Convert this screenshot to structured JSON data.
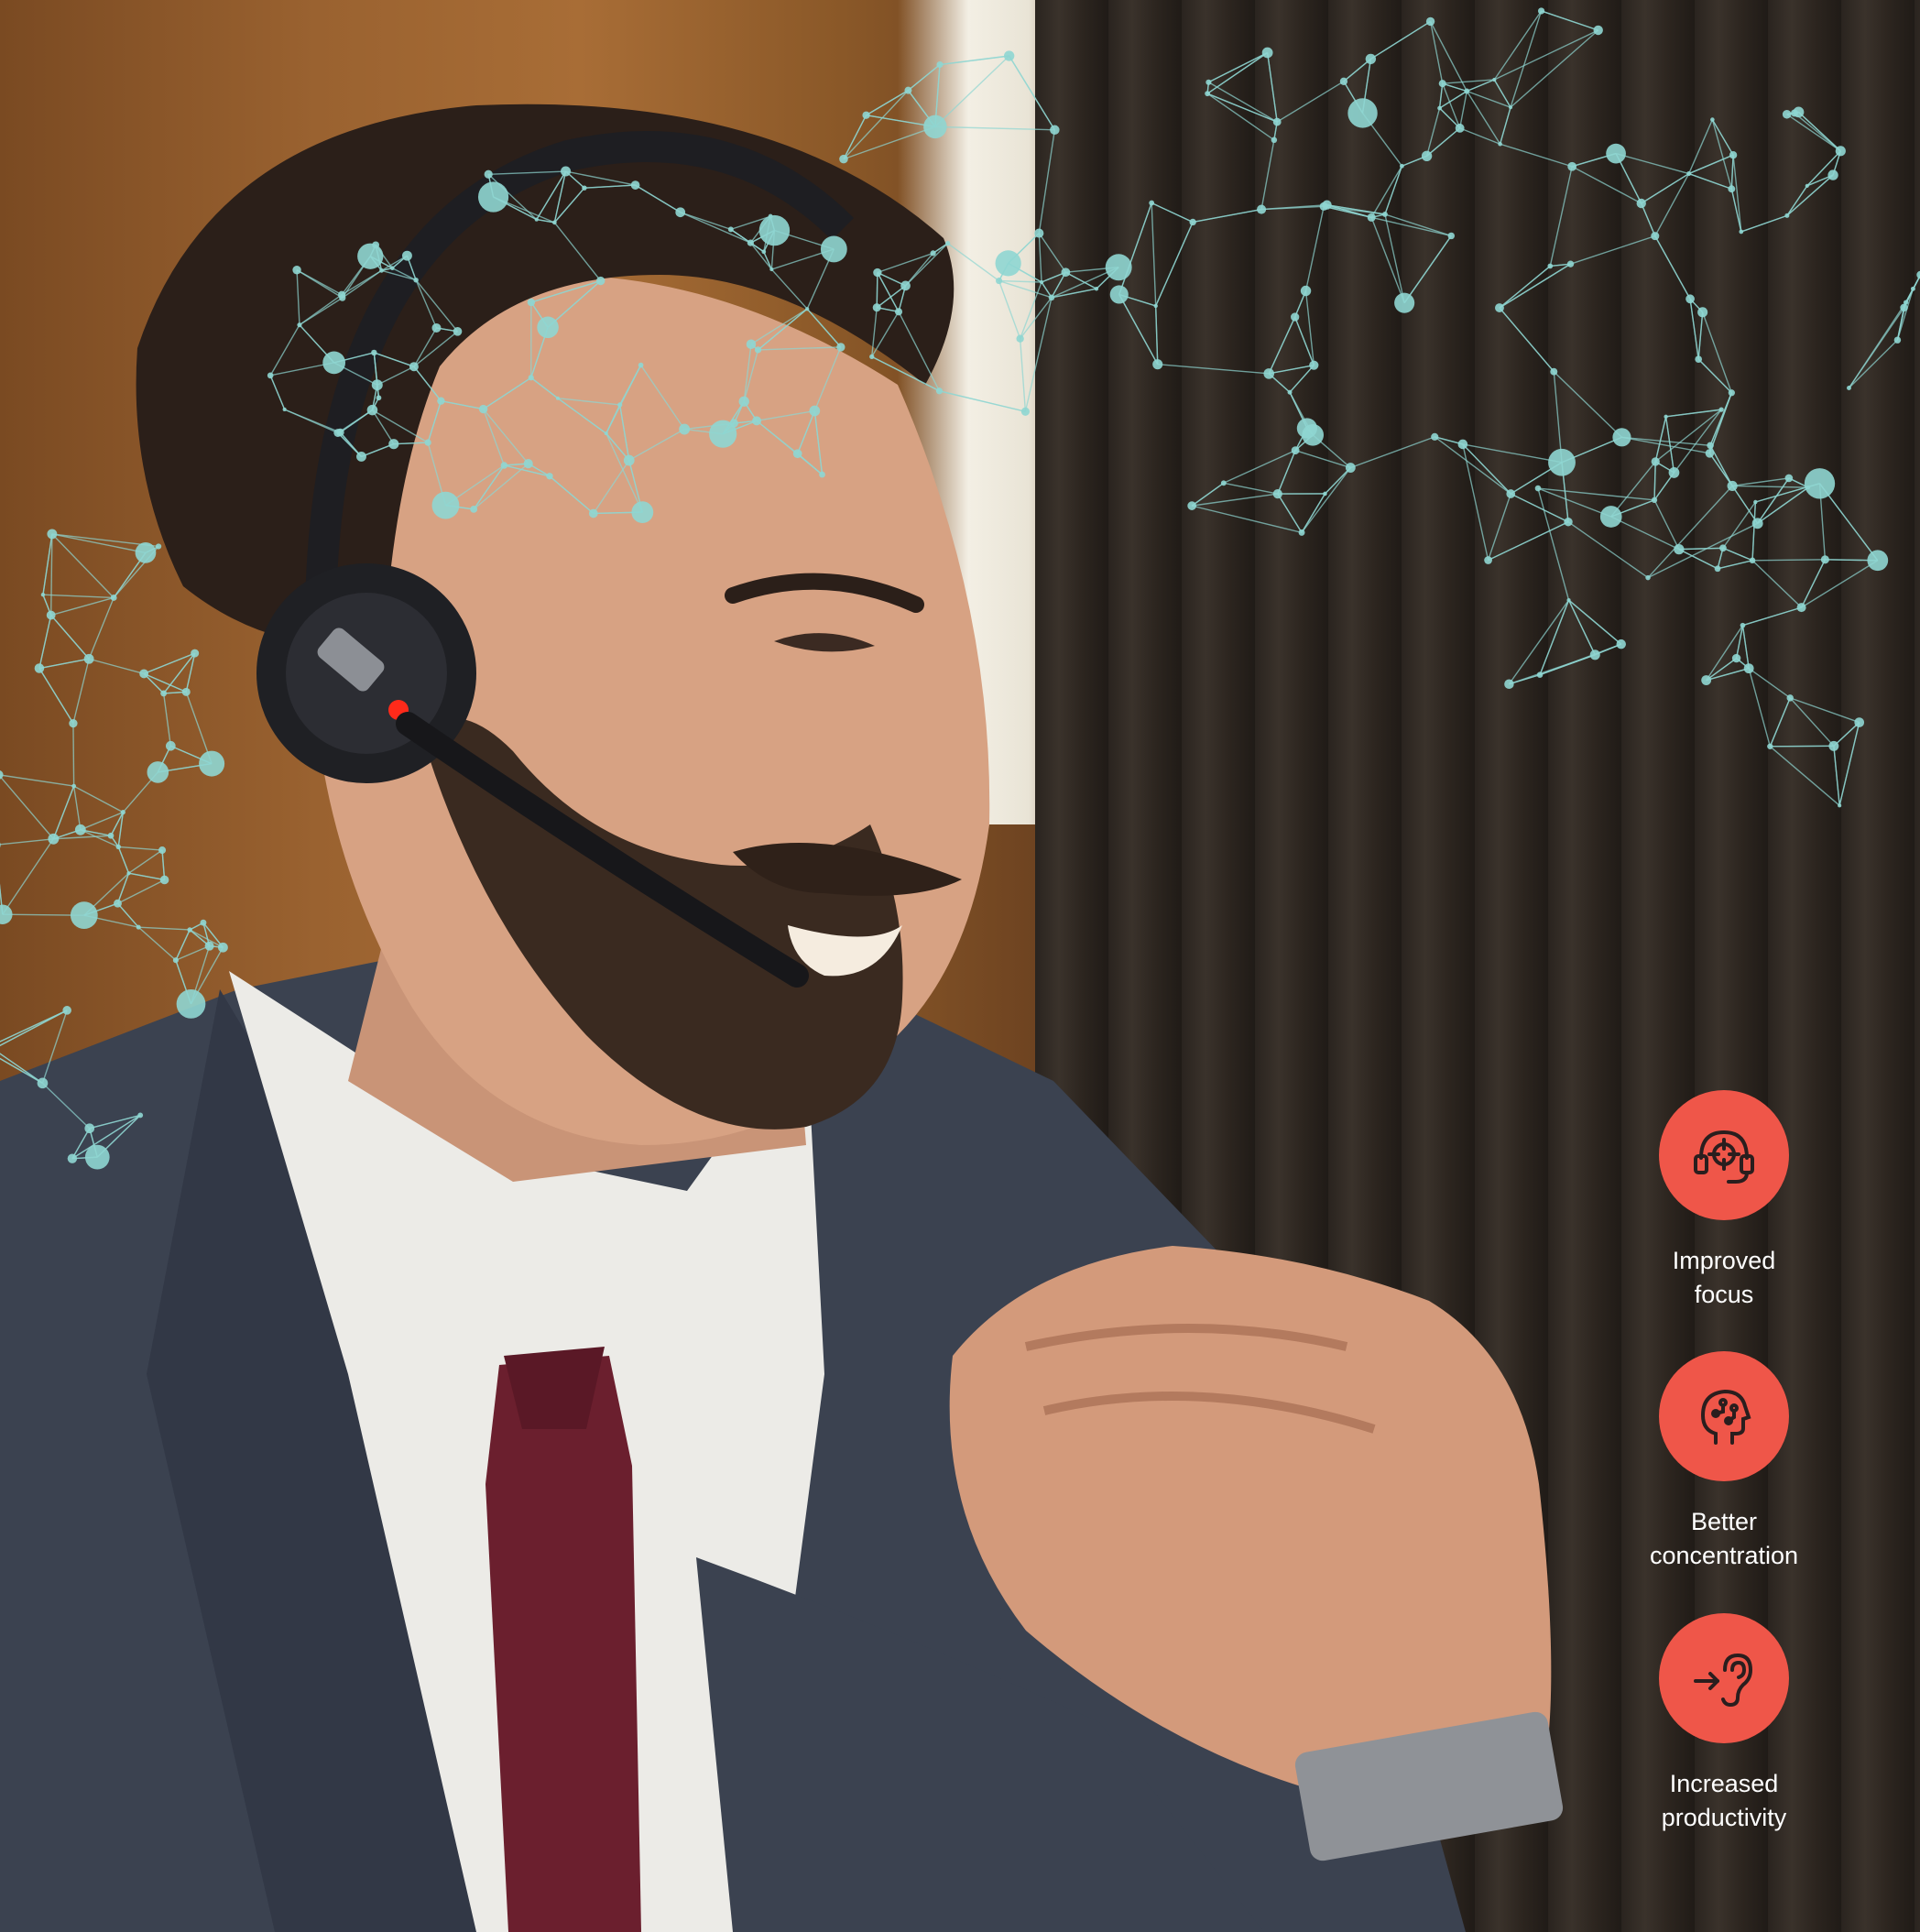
{
  "colors": {
    "accent": "#ef5649",
    "label_text": "#ffffff",
    "network": "#8fd6d2",
    "icon_stroke": "#2a1e1e"
  },
  "benefits": [
    {
      "icon": "headset-target-icon",
      "line1": "Improved",
      "line2": "focus"
    },
    {
      "icon": "head-circuit-icon",
      "line1": "Better",
      "line2": "concentration"
    },
    {
      "icon": "arrow-into-ear-icon",
      "line1": "Increased",
      "line2": "productivity"
    }
  ]
}
